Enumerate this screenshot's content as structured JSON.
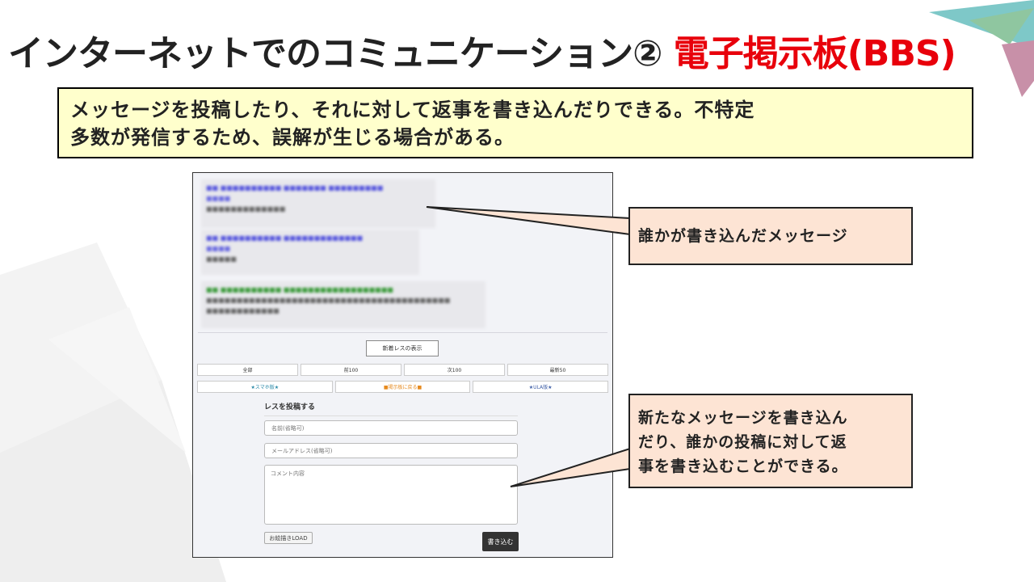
{
  "title": {
    "main": "インターネットでのコミュニケーション②",
    "accent": "電子掲示板(BBS)"
  },
  "lead": {
    "line1": "メッセージを投稿したり、それに対して返事を書き込んだりできる。不特定",
    "line2": "多数が発信するため、誤解が生じる場合がある。"
  },
  "screenshot": {
    "new_res_button": "新着レスの表示",
    "nav1": [
      "全部",
      "前100",
      "次100",
      "最新50"
    ],
    "nav2": [
      "★スマホ版★",
      "■掲示板に戻る■",
      "★ULA版★"
    ],
    "form": {
      "heading": "レスを投稿する",
      "name_placeholder": "名前(省略可)",
      "mail_placeholder": "メールアドレス(省略可)",
      "comment_placeholder": "コメント内容",
      "load_button": "お絵描きLOAD",
      "submit_button": "書き込む"
    }
  },
  "callouts": {
    "message": "誰かが書き込んだメッセージ",
    "reply_line1": "新たなメッセージを書き込ん",
    "reply_line2": "だり、誰かの投稿に対して返",
    "reply_line3": "事を書き込むことができる。"
  },
  "colors": {
    "accent": "#e8000b",
    "lead_bg": "#ffffcc",
    "callout_bg": "#fde4d4"
  }
}
